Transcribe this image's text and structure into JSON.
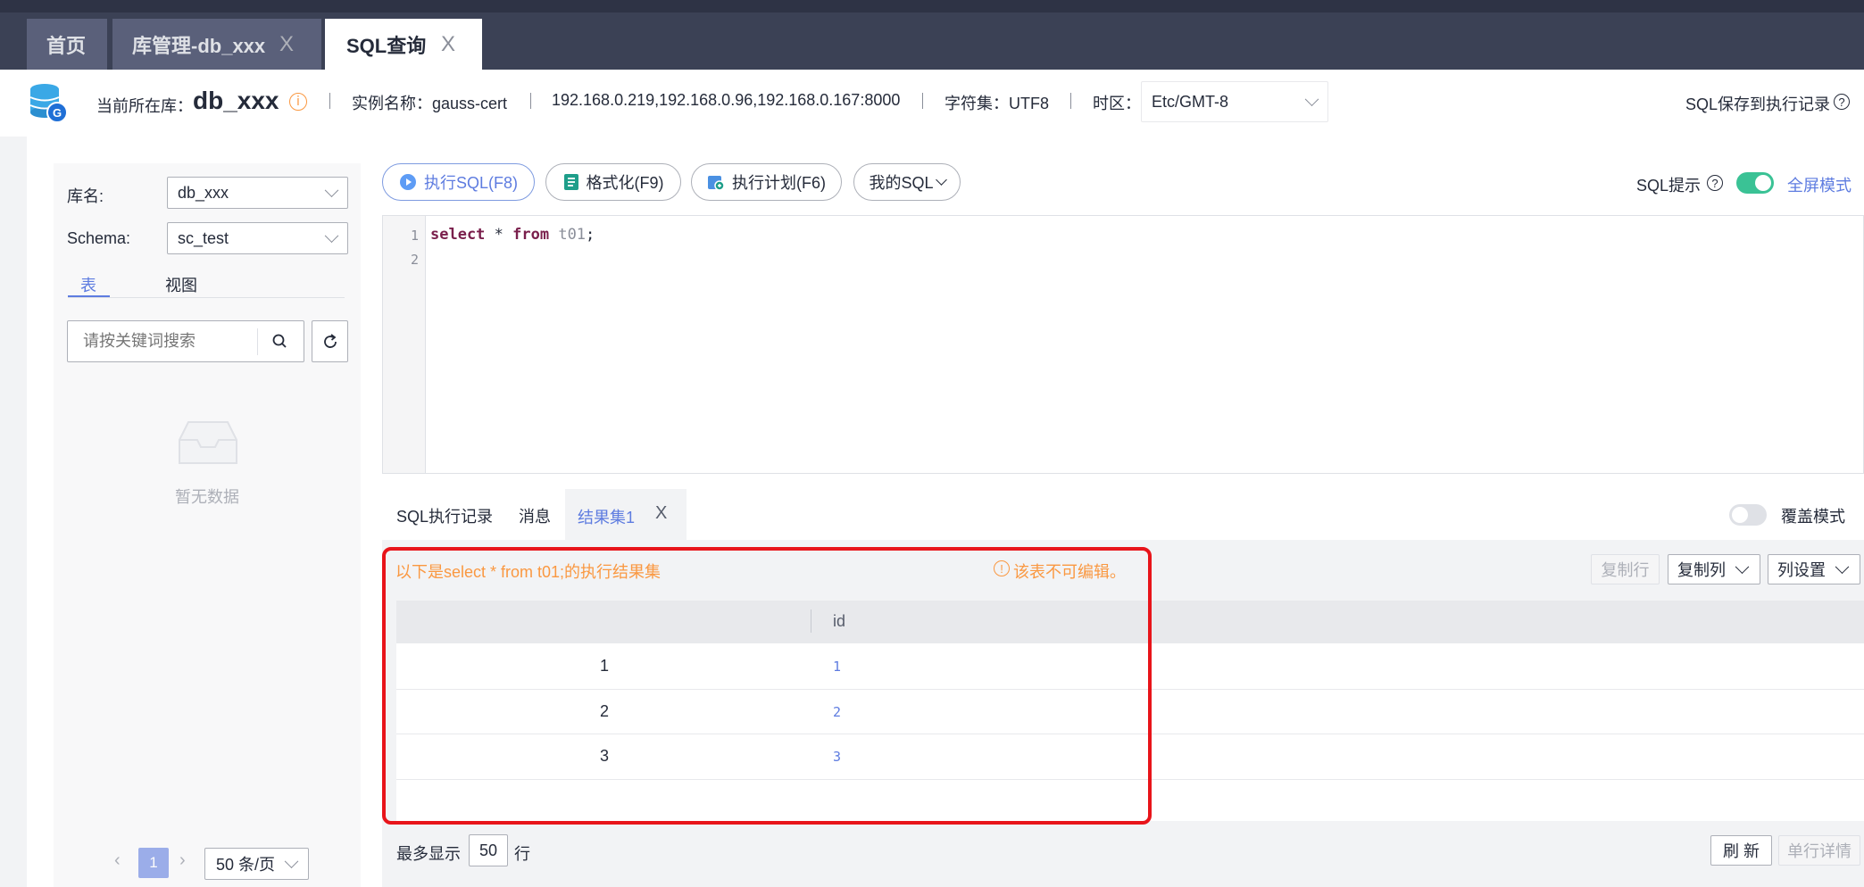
{
  "tabs": [
    {
      "label": "首页",
      "closable": false,
      "active": false
    },
    {
      "label": "库管理-db_xxx",
      "closable": true,
      "active": false
    },
    {
      "label": "SQL查询",
      "closable": true,
      "active": true
    }
  ],
  "close_glyph": "X",
  "infobar": {
    "current_db_label": "当前所在库：",
    "current_db": "db_xxx",
    "instance": "实例名称：gauss-cert",
    "hosts": "192.168.0.219,192.168.0.96,192.168.0.167:8000",
    "charset": "字符集：UTF8",
    "timezone_label": "时区：",
    "timezone_value": "Etc/GMT-8",
    "save_record": "SQL保存到执行记录",
    "info_glyph": "i",
    "help_glyph": "?"
  },
  "sidebar": {
    "db_label": "库名:",
    "db_value": "db_xxx",
    "schema_label": "Schema:",
    "schema_value": "sc_test",
    "tab_table": "表",
    "tab_view": "视图",
    "search_placeholder": "请按关键词搜索",
    "empty_text": "暂无数据",
    "page_current": "1",
    "page_size": "50 条/页"
  },
  "toolbar": {
    "run": "执行SQL(F8)",
    "format": "格式化(F9)",
    "plan": "执行计划(F6)",
    "my_sql": "我的SQL",
    "sql_hint": "SQL提示",
    "fullscreen": "全屏模式"
  },
  "editor": {
    "line_numbers": [
      "1",
      "2"
    ],
    "kw_select": "select",
    "star": " * ",
    "kw_from": "from",
    "table": " t01",
    "semicolon": ";"
  },
  "result_tabs": {
    "history": "SQL执行记录",
    "messages": "消息",
    "resultset": "结果集1",
    "overwrite_mode": "覆盖模式"
  },
  "result": {
    "caption": "以下是select * from t01;的执行结果集",
    "not_editable": "该表不可编辑。",
    "warn_glyph": "!",
    "copy_row": "复制行",
    "copy_col": "复制列",
    "col_settings": "列设置",
    "column_header": "id",
    "rows": [
      {
        "index": "1",
        "id": "1"
      },
      {
        "index": "2",
        "id": "2"
      },
      {
        "index": "3",
        "id": "3"
      }
    ],
    "max_show_label": "最多显示",
    "max_show_value": "50",
    "rows_unit": "行",
    "refresh": "刷 新",
    "row_detail": "单行详情"
  },
  "colors": {
    "accent": "#5e7ce0",
    "warning": "#fa9841",
    "toggle_on": "#3ac295",
    "highlight_box": "#e8141a"
  }
}
